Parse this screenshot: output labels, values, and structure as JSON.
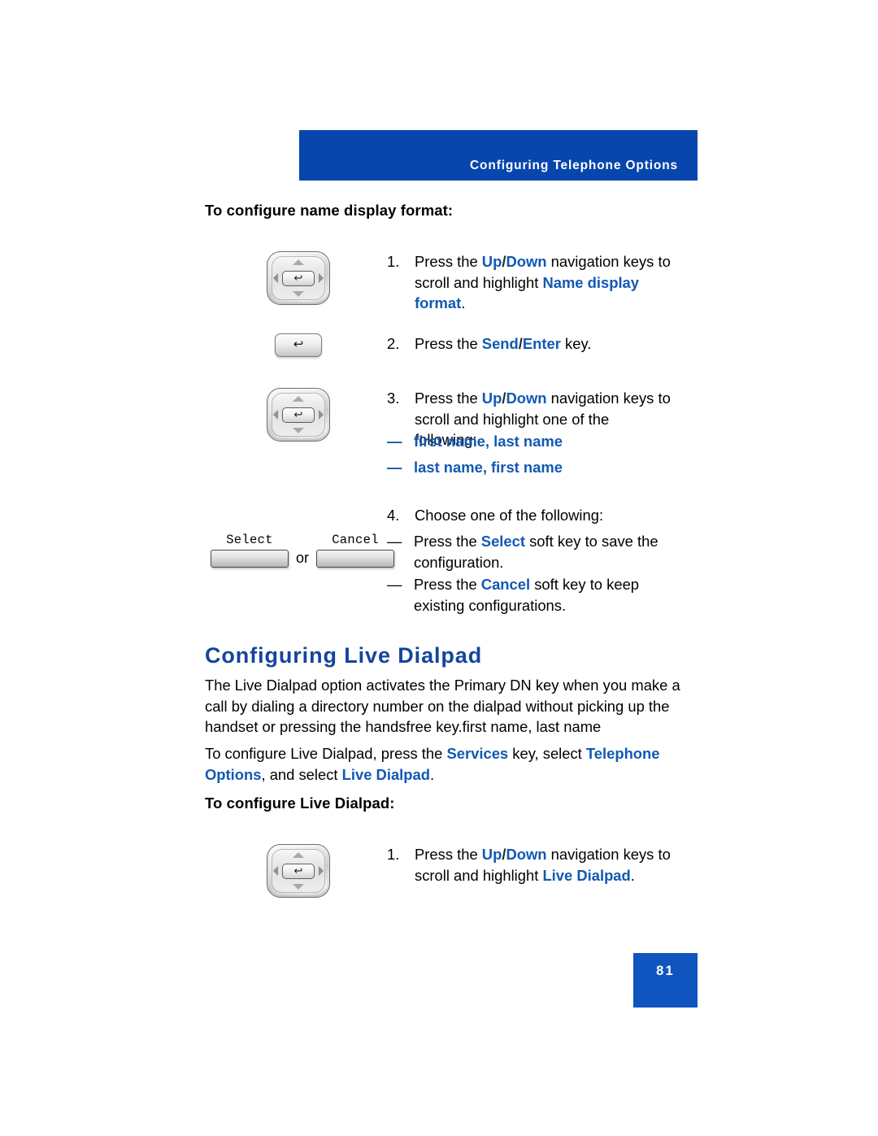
{
  "header": {
    "title": "Configuring Telephone Options"
  },
  "sections": {
    "name_display": {
      "title": "To configure name display format:",
      "steps": [
        {
          "num": "1.",
          "parts": [
            {
              "text": "Press the ",
              "style": "plain"
            },
            {
              "text": "Up",
              "style": "blue"
            },
            {
              "text": "/",
              "style": "sep"
            },
            {
              "text": "Down",
              "style": "blue"
            },
            {
              "text": " navigation keys to scroll and highlight ",
              "style": "plain"
            },
            {
              "text": "Name display format",
              "style": "blue"
            },
            {
              "text": ".",
              "style": "plain"
            }
          ],
          "icon": "navigation-keys-icon"
        },
        {
          "num": "2.",
          "parts": [
            {
              "text": "Press the ",
              "style": "plain"
            },
            {
              "text": "Send",
              "style": "blue"
            },
            {
              "text": "/",
              "style": "sep"
            },
            {
              "text": "Enter",
              "style": "blue"
            },
            {
              "text": " key.",
              "style": "plain"
            }
          ],
          "icon": "enter-key-icon"
        },
        {
          "num": "3.",
          "parts": [
            {
              "text": "Press the ",
              "style": "plain"
            },
            {
              "text": "Up",
              "style": "blue"
            },
            {
              "text": "/",
              "style": "sep"
            },
            {
              "text": "Down",
              "style": "blue"
            },
            {
              "text": " navigation keys to scroll and highlight one of the following:",
              "style": "plain"
            }
          ],
          "icon": "navigation-keys-icon"
        },
        {
          "num": "4.",
          "parts": [
            {
              "text": "Choose one of the following:",
              "style": "plain"
            }
          ],
          "icon": "softkeys-icon"
        }
      ],
      "name_format_options": [
        {
          "dash": "—",
          "label": "first name, last name"
        },
        {
          "dash": "—",
          "label": "last name, first name"
        }
      ],
      "choice_bullets": [
        {
          "dash": "—",
          "parts": [
            {
              "text": "Press the ",
              "style": "plain"
            },
            {
              "text": "Select",
              "style": "blue"
            },
            {
              "text": " soft key to save the configuration.",
              "style": "plain"
            }
          ]
        },
        {
          "dash": "—",
          "parts": [
            {
              "text": "Press the ",
              "style": "plain"
            },
            {
              "text": "Cancel",
              "style": "blue"
            },
            {
              "text": " soft key to keep existing configurations.",
              "style": "plain"
            }
          ]
        }
      ],
      "softkeys": {
        "select_label": "Select",
        "or_label": "or",
        "cancel_label": "Cancel"
      }
    },
    "live_dialpad": {
      "heading": "Configuring Live Dialpad",
      "paragraph_1": "The Live Dialpad option activates the Primary DN key when you make a call by dialing a directory number on the dialpad without picking up the handset or pressing the handsfree key.first name, last name",
      "paragraph_2_parts": [
        {
          "text": "To configure Live Dialpad, press the ",
          "style": "plain"
        },
        {
          "text": "Services",
          "style": "blue"
        },
        {
          "text": " key, select ",
          "style": "plain"
        },
        {
          "text": "Telephone Options",
          "style": "blue"
        },
        {
          "text": ", and select ",
          "style": "plain"
        },
        {
          "text": "Live Dialpad",
          "style": "blue"
        },
        {
          "text": ".",
          "style": "plain"
        }
      ],
      "title": "To configure Live Dialpad:",
      "steps": [
        {
          "num": "1.",
          "parts": [
            {
              "text": "Press the ",
              "style": "plain"
            },
            {
              "text": "Up",
              "style": "blue"
            },
            {
              "text": "/",
              "style": "sep"
            },
            {
              "text": "Down",
              "style": "blue"
            },
            {
              "text": " navigation keys to scroll and highlight ",
              "style": "plain"
            },
            {
              "text": "Live Dialpad",
              "style": "blue"
            },
            {
              "text": ".",
              "style": "plain"
            }
          ],
          "icon": "navigation-keys-icon"
        }
      ]
    }
  },
  "footer": {
    "page_number": "81"
  },
  "colors": {
    "banner_blue": "#0746ad",
    "heading_blue": "#15449e",
    "inline_blue": "#1259b3",
    "page_box_blue": "#1054bf"
  }
}
